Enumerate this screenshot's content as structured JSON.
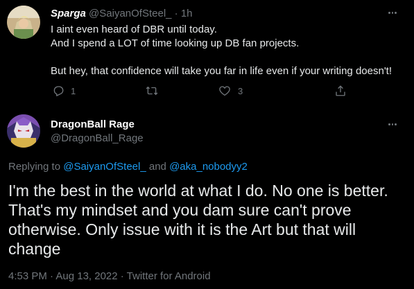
{
  "reply": {
    "display_name": "Sparga",
    "handle": "@SaiyanOfSteel_",
    "separator": " · ",
    "time": "1h",
    "lines": [
      "I aint even heard of DBR until today.",
      "And I spend a LOT of time looking up DB fan projects.",
      "But hey, that confidence will take you far in life even if your writing doesn't!"
    ],
    "actions": {
      "reply_count": "1",
      "retweet_count": "",
      "like_count": "3"
    }
  },
  "main": {
    "display_name": "DragonBall Rage",
    "handle": "@DragonBall_Rage",
    "replying_prefix": "Replying to ",
    "mention_1": "@SaiyanOfSteel_",
    "replying_and": " and ",
    "mention_2": "@aka_nobodyy2",
    "text": "I'm the best in the world at what I do. No one is better. That's my mindset and you dam sure can't prove otherwise. Only issue with it is the Art but that will change",
    "timestamp": "4:53 PM · Aug 13, 2022 · Twitter for Android"
  },
  "icons": {
    "reply": "reply-icon",
    "retweet": "retweet-icon",
    "like": "heart-icon",
    "share": "share-icon",
    "more": "more-icon"
  },
  "colors": {
    "background": "#000000",
    "text_primary": "#e7e9ea",
    "text_secondary": "#71767b",
    "link": "#1d9bf0"
  }
}
